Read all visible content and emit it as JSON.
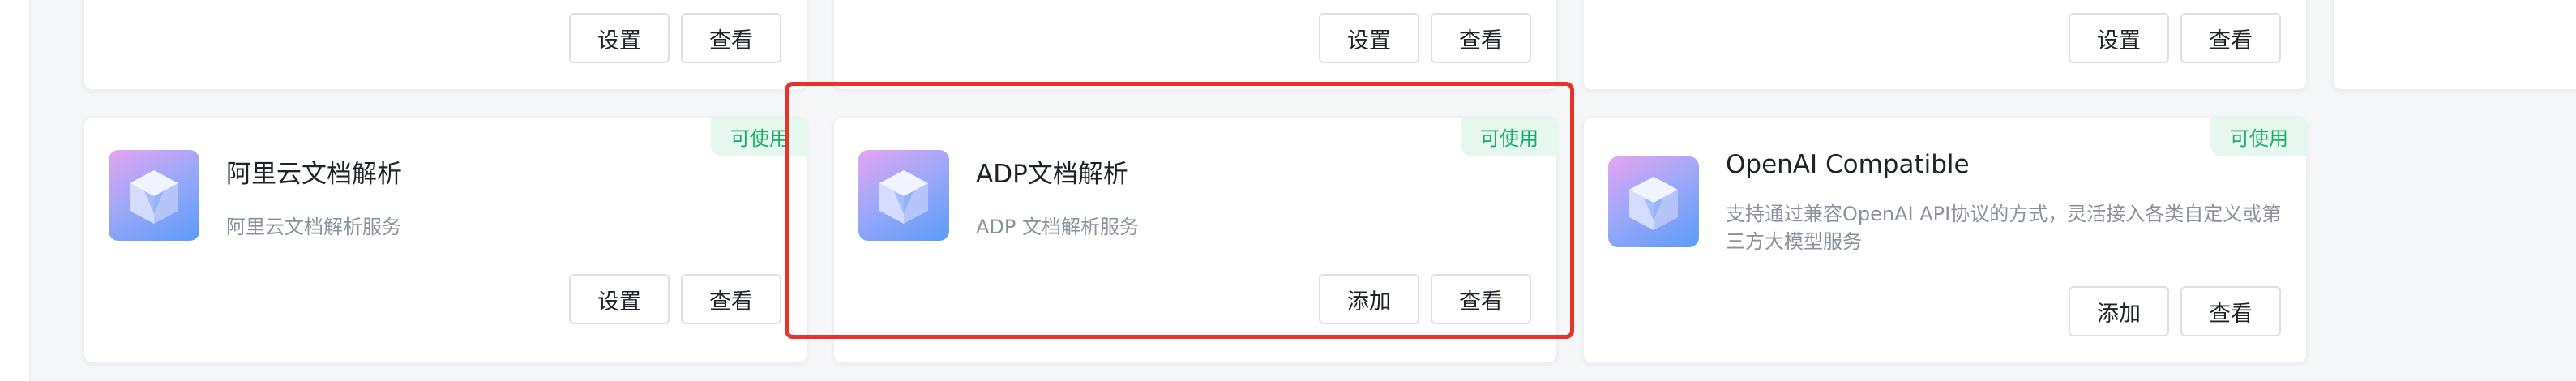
{
  "top_row": [
    {
      "settings_label": "设置",
      "view_label": "查看"
    },
    {
      "settings_label": "设置",
      "view_label": "查看"
    },
    {
      "settings_label": "设置",
      "view_label": "查看"
    }
  ],
  "cards": [
    {
      "title": "阿里云文档解析",
      "description": "阿里云文档解析服务",
      "status": "可使用",
      "primary_button": "设置",
      "secondary_button": "查看",
      "icon": "cube-icon"
    },
    {
      "title": "ADP文档解析",
      "description": "ADP 文档解析服务",
      "status": "可使用",
      "primary_button": "添加",
      "secondary_button": "查看",
      "icon": "cube-icon",
      "highlighted": true
    },
    {
      "title": "OpenAI Compatible",
      "description": "支持通过兼容OpenAI API协议的方式，灵活接入各类自定义或第三方大模型服务",
      "status": "可使用",
      "primary_button": "添加",
      "secondary_button": "查看",
      "icon": "cube-icon"
    }
  ],
  "colors": {
    "badge_text": "#1aad6a",
    "badge_bg": "#e6f7ef",
    "highlight": "#e8322a"
  }
}
